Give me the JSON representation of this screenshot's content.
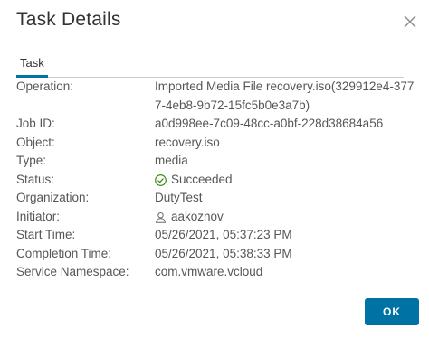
{
  "dialog": {
    "title": "Task Details",
    "close_icon": "close-icon",
    "ok_label": "OK"
  },
  "tabs": [
    {
      "label": "Task",
      "active": true
    }
  ],
  "details": {
    "operation": {
      "label": "Operation:",
      "value": "Imported Media File recovery.iso(329912e4-3777-4eb8-9b72-15fc5b0e3a7b)"
    },
    "job_id": {
      "label": "Job ID:",
      "value": "a0d998ee-7c09-48cc-a0bf-228d38684a56"
    },
    "object": {
      "label": "Object:",
      "value": "recovery.iso"
    },
    "type": {
      "label": "Type:",
      "value": "media"
    },
    "status": {
      "label": "Status:",
      "value": "Succeeded",
      "icon": "check-circle-icon",
      "icon_color": "#2f8400"
    },
    "organization": {
      "label": "Organization:",
      "value": "DutyTest"
    },
    "initiator": {
      "label": "Initiator:",
      "value": "aakoznov",
      "icon": "user-icon"
    },
    "start_time": {
      "label": "Start Time:",
      "value": "05/26/2021, 05:37:23 PM"
    },
    "completion_time": {
      "label": "Completion Time:",
      "value": "05/26/2021, 05:38:33 PM"
    },
    "service_namespace": {
      "label": "Service Namespace:",
      "value": "com.vmware.vcloud"
    }
  },
  "colors": {
    "accent": "#0072a3",
    "text": "#565656",
    "title": "#333333",
    "divider": "#cccccc"
  }
}
